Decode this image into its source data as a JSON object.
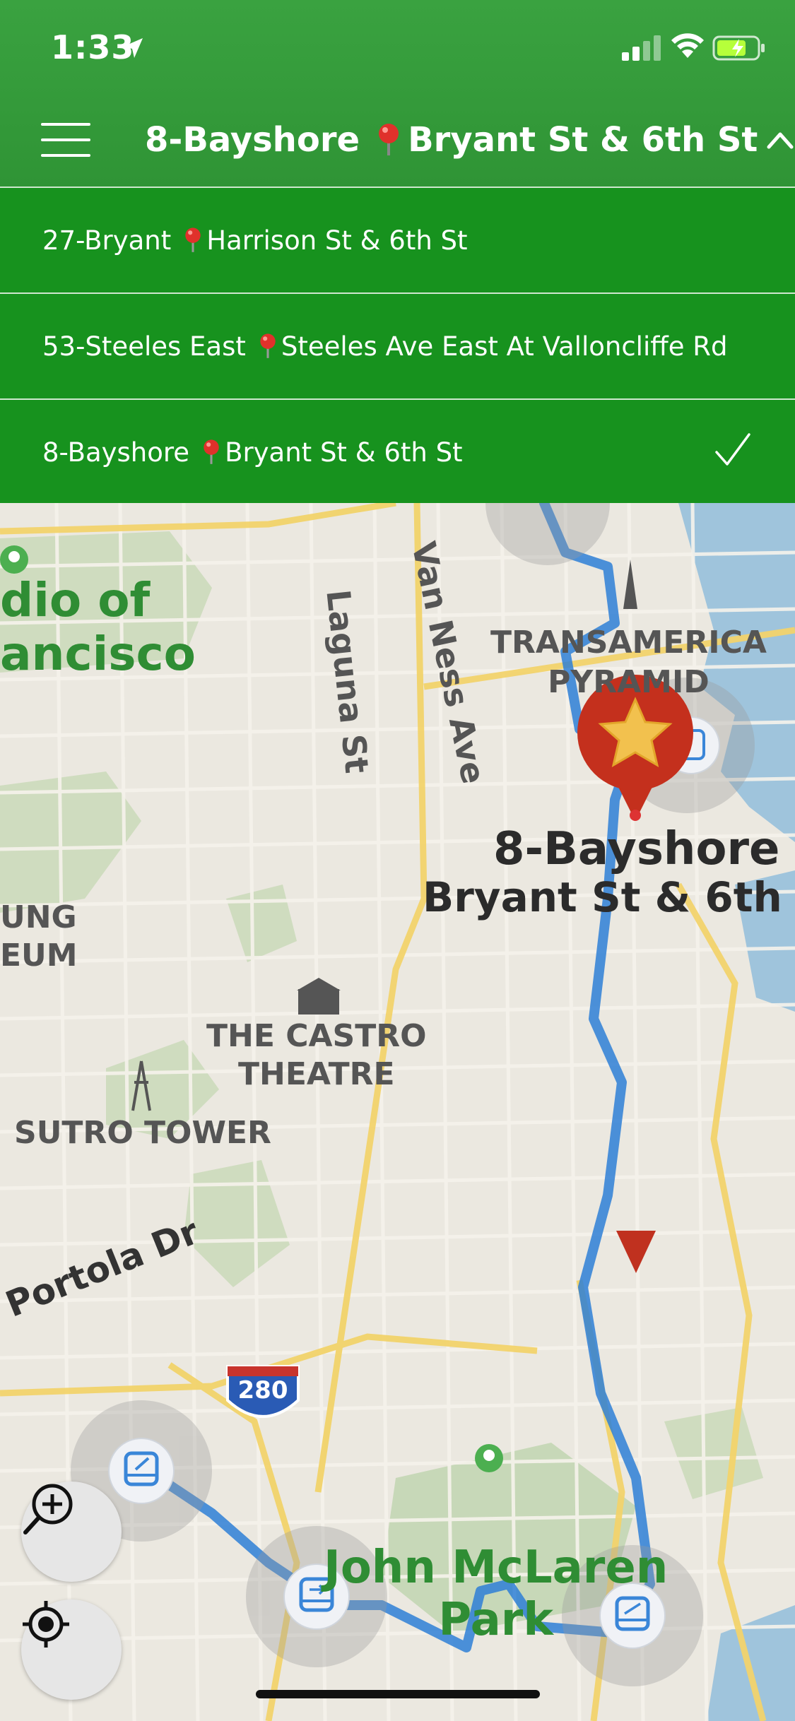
{
  "status_bar": {
    "time": "1:33",
    "icons": [
      "location-arrow-icon",
      "signal-icon",
      "wifi-icon",
      "battery-charging-icon"
    ]
  },
  "header": {
    "route": "8-Bayshore",
    "stop": "Bryant St & 6th St",
    "menu_icon": "hamburger-menu-icon",
    "pin_icon": "red-pushpin-icon",
    "toggle_icon": "chevron-up-icon",
    "color": "#33993a"
  },
  "routes": [
    {
      "route": "27-Bryant",
      "stop": "Harrison St & 6th St",
      "selected": false
    },
    {
      "route": "53-Steeles East",
      "stop": "Steeles Ave East At Valloncliffe Rd",
      "selected": false
    },
    {
      "route": "8-Bayshore",
      "stop": "Bryant St & 6th St",
      "selected": true
    }
  ],
  "route_list_color": "#17921e",
  "map": {
    "labels": {
      "presidio": [
        "dio of",
        "ancisco"
      ],
      "transamerica": [
        "TRANSAMERICA",
        "PYRAMID"
      ],
      "laguna": "Laguna St",
      "van_ness": "Van Ness Ave",
      "de_young": [
        "UNG",
        "EUM"
      ],
      "castro": [
        "THE CASTRO",
        "THEATRE"
      ],
      "sutro": "SUTRO TOWER",
      "portola": "Portola Dr",
      "highway": "280",
      "mclaren": [
        "John McLaren",
        "Park"
      ]
    },
    "selected_stop": {
      "route": "8-Bayshore",
      "stop": "Bryant St & 6th",
      "icon": "star-icon"
    },
    "route_color": "#2e7fd6",
    "bus_stop_icon": "bus-icon"
  },
  "controls": {
    "zoom": "zoom-in-icon",
    "locate": "locate-me-icon"
  }
}
